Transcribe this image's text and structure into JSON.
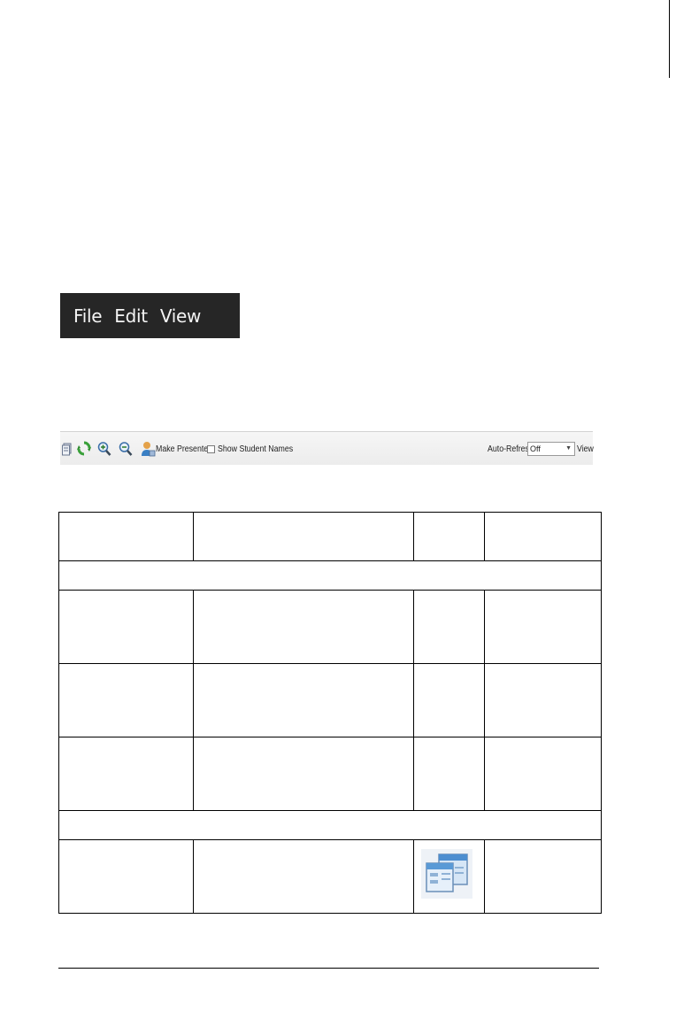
{
  "menubar": {
    "items": [
      "File",
      "Edit",
      "View"
    ]
  },
  "toolbar": {
    "make_presenter_label": "Make Presenter",
    "show_student_names_label": "Show Student Names",
    "auto_refresh_label": "Auto-Refresh:",
    "auto_refresh_value": "Off",
    "view_label": "View"
  },
  "colors": {
    "menubar_bg": "#262626",
    "menubar_text": "#f4f4f4",
    "icon_green": "#3aa03a",
    "icon_blue": "#3a7fc4"
  },
  "icons": [
    "document-icon",
    "refresh-icon",
    "zoom-in-icon",
    "zoom-out-icon",
    "presenter-icon",
    "dropdown-arrow-icon",
    "screen-view-icon"
  ]
}
